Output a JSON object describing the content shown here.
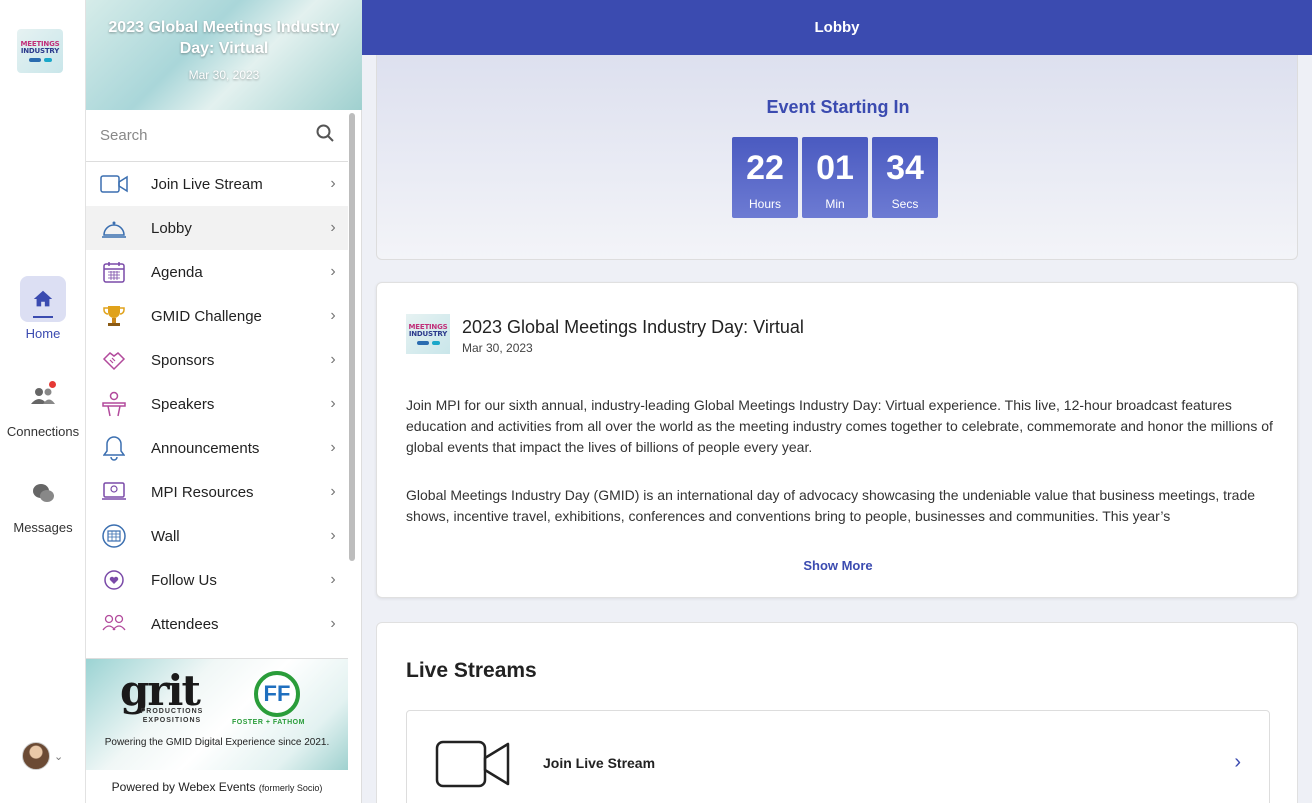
{
  "colors": {
    "accent": "#3b4bb0",
    "timer": "#4a5ac0",
    "badge": "#e53935"
  },
  "rail": {
    "logo_text": [
      "MEETINGS",
      "INDUSTRY"
    ],
    "items": [
      {
        "label": "Home",
        "icon": "home-icon",
        "active": true
      },
      {
        "label": "Connections",
        "icon": "people-icon",
        "badge": true
      },
      {
        "label": "Messages",
        "icon": "chat-bubbles-icon"
      }
    ]
  },
  "sidebar": {
    "title": "2023 Global Meetings Industry Day: Virtual",
    "date": "Mar 30, 2023",
    "search_placeholder": "Search",
    "items": [
      {
        "label": "Join Live Stream",
        "icon": "video-camera-icon"
      },
      {
        "label": "Lobby",
        "icon": "service-bell-icon",
        "active": true
      },
      {
        "label": "Agenda",
        "icon": "calendar-icon"
      },
      {
        "label": "GMID Challenge",
        "icon": "trophy-icon"
      },
      {
        "label": "Sponsors",
        "icon": "handshake-icon"
      },
      {
        "label": "Speakers",
        "icon": "podium-speaker-icon"
      },
      {
        "label": "Announcements",
        "icon": "bell-icon"
      },
      {
        "label": "MPI Resources",
        "icon": "resources-icon"
      },
      {
        "label": "Wall",
        "icon": "wall-icon"
      },
      {
        "label": "Follow Us",
        "icon": "heart-circle-icon"
      },
      {
        "label": "Attendees",
        "icon": "attendees-icon"
      }
    ],
    "sponsor": {
      "grit": "grit",
      "grit_sub": "PRODUCTIONS EXPOSITIONS",
      "ff_letters": "FF",
      "ff_name": "FOSTER + FATHOM",
      "tagline": "Powering the GMID Digital Experience since 2021."
    },
    "powered_by": "Powered by Webex Events",
    "powered_by_small": "(formerly Socio)"
  },
  "topbar": {
    "title": "Lobby"
  },
  "countdown": {
    "title": "Event Starting In",
    "units": [
      {
        "value": "22",
        "label": "Hours"
      },
      {
        "value": "01",
        "label": "Min"
      },
      {
        "value": "34",
        "label": "Secs"
      }
    ]
  },
  "event": {
    "title": "2023 Global Meetings Industry Day: Virtual",
    "date": "Mar 30, 2023",
    "paragraph1": "Join MPI for our sixth annual, industry-leading Global Meetings Industry Day: Virtual experience. This live, 12-hour broadcast features education and activities from all over the world as the meeting industry comes together to celebrate, commemorate and honor the millions of global events that impact the lives of billions of people every year.",
    "paragraph2": "Global Meetings Industry Day (GMID) is an international day of advocacy showcasing the undeniable value that business meetings, trade shows, incentive travel, exhibitions, conferences and conventions bring to people, businesses and communities. This year’s",
    "show_more": "Show More"
  },
  "live_streams": {
    "title": "Live Streams",
    "item_label": "Join Live Stream"
  }
}
